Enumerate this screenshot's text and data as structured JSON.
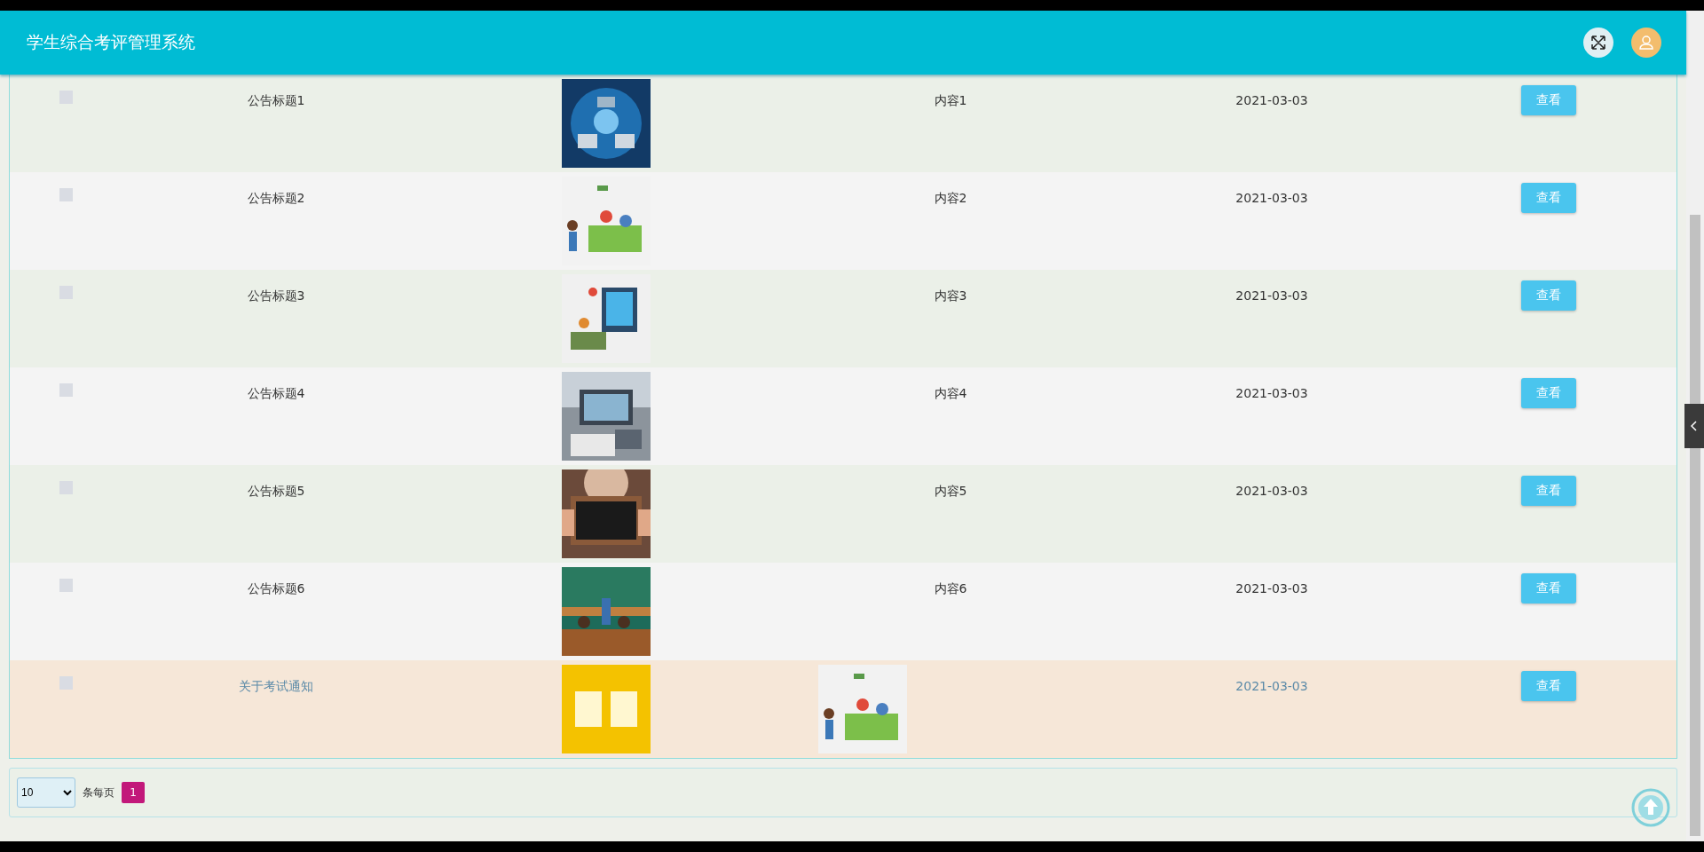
{
  "header": {
    "title": "学生综合考评管理系统"
  },
  "table": {
    "rows": [
      {
        "checked": false,
        "highlighted": false,
        "title": "公告标题1",
        "content": {
          "kind": "text",
          "text": "内容1"
        },
        "date": "2021-03-03",
        "action": "查看"
      },
      {
        "checked": false,
        "highlighted": false,
        "title": "公告标题2",
        "content": {
          "kind": "text",
          "text": "内容2"
        },
        "date": "2021-03-03",
        "action": "查看"
      },
      {
        "checked": false,
        "highlighted": false,
        "title": "公告标题3",
        "content": {
          "kind": "text",
          "text": "内容3"
        },
        "date": "2021-03-03",
        "action": "查看"
      },
      {
        "checked": false,
        "highlighted": false,
        "title": "公告标题4",
        "content": {
          "kind": "text",
          "text": "内容4"
        },
        "date": "2021-03-03",
        "action": "查看"
      },
      {
        "checked": false,
        "highlighted": false,
        "title": "公告标题5",
        "content": {
          "kind": "text",
          "text": "内容5"
        },
        "date": "2021-03-03",
        "action": "查看"
      },
      {
        "checked": false,
        "highlighted": false,
        "title": "公告标题6",
        "content": {
          "kind": "text",
          "text": "内容6"
        },
        "date": "2021-03-03",
        "action": "查看"
      },
      {
        "checked": false,
        "highlighted": true,
        "title": "关于考试通知",
        "date": "2021-03-03",
        "action": "查看"
      }
    ]
  },
  "pagination": {
    "page_size": "10",
    "per_page_label": "条每页",
    "pages": [
      {
        "label": "1",
        "selected": true
      }
    ]
  }
}
